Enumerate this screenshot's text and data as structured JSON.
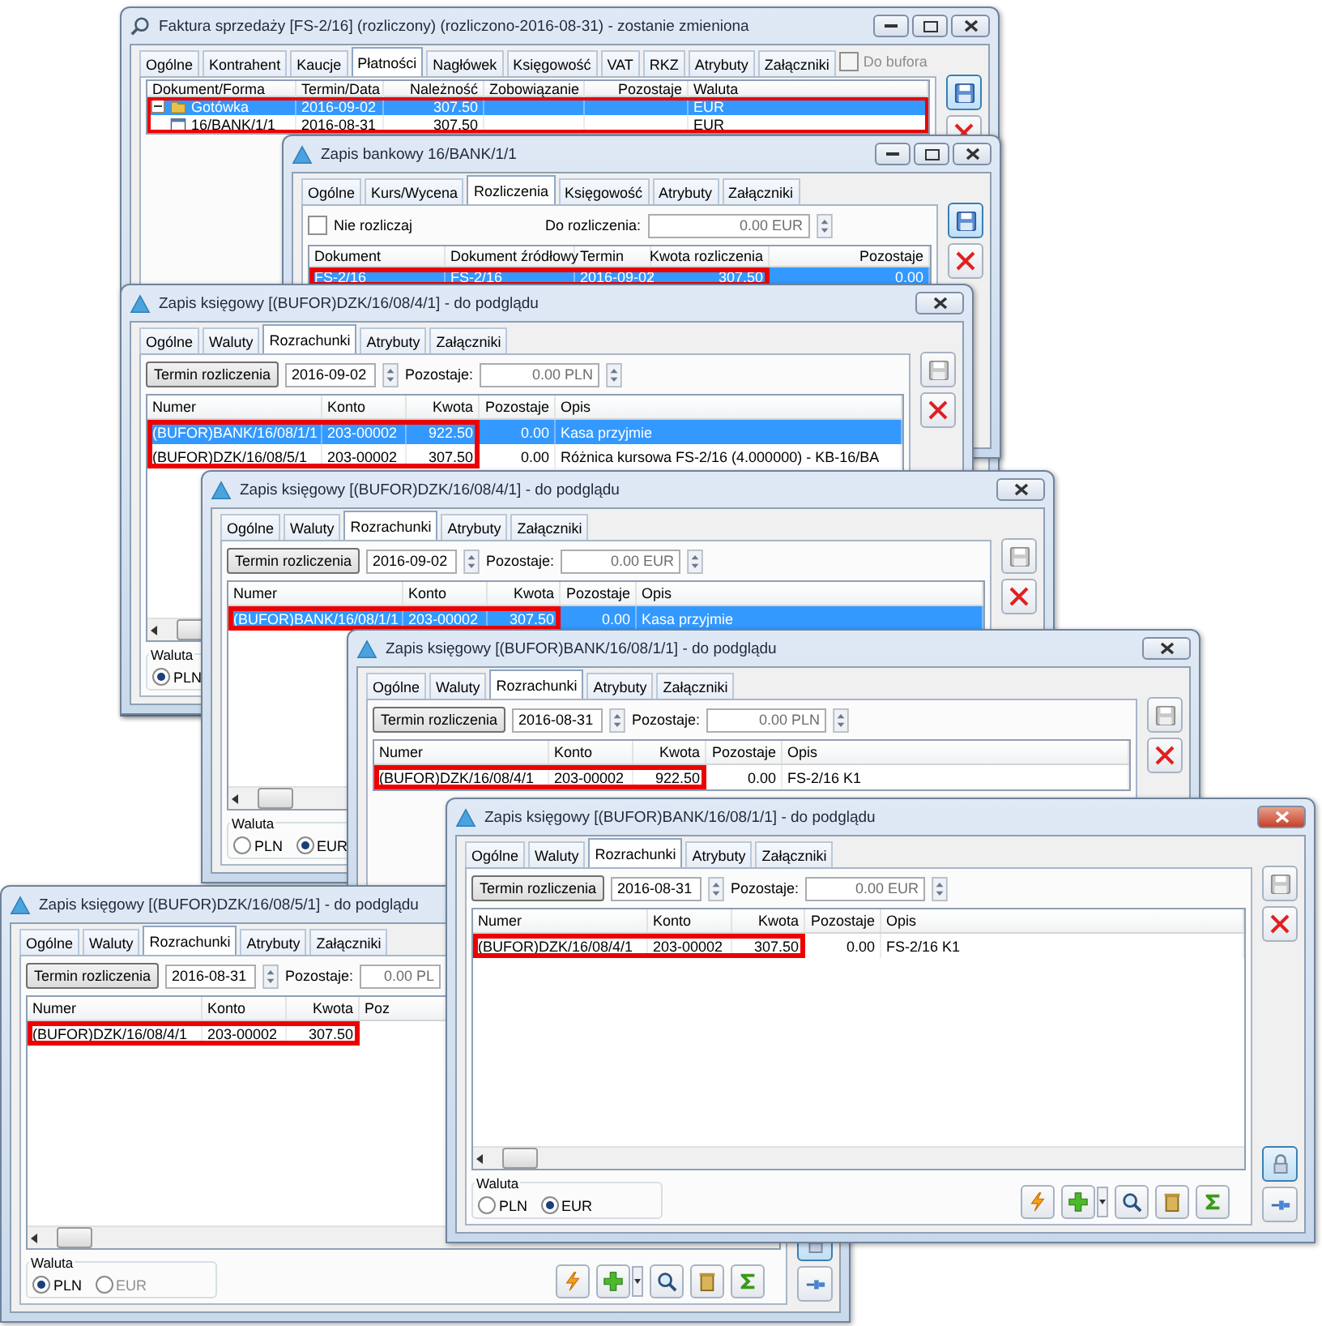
{
  "windows": [
    {
      "kind": "invoice",
      "title": "Faktura sprzedaży [FS-2/16] (rozliczony) (rozliczono-2016-08-31) - zostanie zmieniona",
      "active": false,
      "save_enabled": true,
      "tabs": [
        {
          "label": "Ogólne",
          "selected": false
        },
        {
          "label": "Kontrahent",
          "selected": false
        },
        {
          "label": "Kaucje",
          "selected": false
        },
        {
          "label": "Płatności",
          "selected": true
        },
        {
          "label": "Nagłówek",
          "selected": false
        },
        {
          "label": "Księgowość",
          "selected": false
        },
        {
          "label": "VAT",
          "selected": false
        },
        {
          "label": "RKZ",
          "selected": false
        },
        {
          "label": "Atrybuty",
          "selected": false
        },
        {
          "label": "Załączniki",
          "selected": false
        }
      ],
      "do_bufora": {
        "label": "Do bufora",
        "checked": false,
        "disabled": true
      },
      "table": {
        "columns": [
          {
            "label": "Dokument/Forma"
          },
          {
            "label": "Termin/Data"
          },
          {
            "label": "Należność"
          },
          {
            "label": "Zobowiązanie"
          },
          {
            "label": "Pozostaje"
          },
          {
            "label": "Waluta"
          }
        ],
        "rows": [
          {
            "cells": [
              "Gotówka",
              "2016-09-02",
              "307.50",
              "",
              "",
              "EUR"
            ],
            "selected": true,
            "highlighted": true,
            "expanded": true,
            "children": [
              {
                "cells": [
                  "16/BANK/1/1",
                  "2016-08-31",
                  "307.50",
                  "",
                  "",
                  "EUR"
                ],
                "selected": false,
                "highlighted": true
              }
            ]
          }
        ]
      }
    },
    {
      "kind": "bank",
      "title": "Zapis bankowy 16/BANK/1/1",
      "active": false,
      "save_enabled": true,
      "tabs": [
        {
          "label": "Ogólne",
          "selected": false
        },
        {
          "label": "Kurs/Wycena",
          "selected": false
        },
        {
          "label": "Rozliczenia",
          "selected": true
        },
        {
          "label": "Księgowość",
          "selected": false
        },
        {
          "label": "Atrybuty",
          "selected": false
        },
        {
          "label": "Załączniki",
          "selected": false
        }
      ],
      "filter": {
        "kind": "settle",
        "checkbox": {
          "label": "Nie rozliczaj",
          "checked": false
        },
        "label": "Do rozliczenia:",
        "value": "0.00 EUR"
      },
      "table": {
        "columns": [
          {
            "label": "Dokument"
          },
          {
            "label": "Dokument źródłowy"
          },
          {
            "label": "Termin"
          },
          {
            "label": "Kwota rozliczenia"
          },
          {
            "label": "Pozostaje"
          }
        ],
        "rows": [
          {
            "cells": [
              "FS-2/16",
              "FS-2/16",
              "2016-09-02",
              "307.50",
              "0.00"
            ],
            "selected": true,
            "highlighted": true
          }
        ]
      }
    },
    {
      "kind": "ledger",
      "title": "Zapis księgowy [(BUFOR)DZK/16/08/4/1] - do podglądu",
      "active": false,
      "save_enabled": false,
      "tabs": [
        {
          "label": "Ogólne",
          "selected": false
        },
        {
          "label": "Waluty",
          "selected": false
        },
        {
          "label": "Rozrachunki",
          "selected": true
        },
        {
          "label": "Atrybuty",
          "selected": false
        },
        {
          "label": "Załączniki",
          "selected": false
        }
      ],
      "filter": {
        "kind": "term",
        "button": "Termin rozliczenia",
        "date": "2016-09-02",
        "label": "Pozostaje:",
        "value": "0.00 PLN"
      },
      "table": {
        "columns": [
          {
            "label": "Numer"
          },
          {
            "label": "Konto"
          },
          {
            "label": "Kwota"
          },
          {
            "label": "Pozostaje"
          },
          {
            "label": "Opis"
          }
        ],
        "rows": [
          {
            "cells": [
              "(BUFOR)BANK/16/08/1/1",
              "203-00002",
              "922.50",
              "0.00",
              "Kasa przyjmie"
            ],
            "selected": true,
            "highlighted": true
          },
          {
            "cells": [
              "(BUFOR)DZK/16/08/5/1",
              "203-00002",
              "307.50",
              "0.00",
              "Różnica kursowa FS-2/16 (4.000000) - KB-16/BA"
            ],
            "selected": false,
            "highlighted": true
          }
        ]
      },
      "waluta": {
        "label": "Waluta",
        "options": [
          {
            "label": "PLN",
            "selected": true,
            "disabled": false
          }
        ]
      }
    },
    {
      "kind": "ledger",
      "title": "Zapis księgowy [(BUFOR)DZK/16/08/4/1] - do podglądu",
      "active": false,
      "save_enabled": false,
      "tabs": [
        {
          "label": "Ogólne",
          "selected": false
        },
        {
          "label": "Waluty",
          "selected": false
        },
        {
          "label": "Rozrachunki",
          "selected": true
        },
        {
          "label": "Atrybuty",
          "selected": false
        },
        {
          "label": "Załączniki",
          "selected": false
        }
      ],
      "filter": {
        "kind": "term",
        "button": "Termin rozliczenia",
        "date": "2016-09-02",
        "label": "Pozostaje:",
        "value": "0.00 EUR"
      },
      "table": {
        "columns": [
          {
            "label": "Numer"
          },
          {
            "label": "Konto"
          },
          {
            "label": "Kwota"
          },
          {
            "label": "Pozostaje"
          },
          {
            "label": "Opis"
          }
        ],
        "rows": [
          {
            "cells": [
              "(BUFOR)BANK/16/08/1/1",
              "203-00002",
              "307.50",
              "0.00",
              "Kasa przyjmie"
            ],
            "selected": true,
            "highlighted": true
          }
        ]
      },
      "waluta": {
        "label": "Waluta",
        "options": [
          {
            "label": "PLN",
            "selected": false,
            "disabled": false
          },
          {
            "label": "EUR",
            "selected": true,
            "disabled": false
          }
        ]
      }
    },
    {
      "kind": "ledger",
      "title": "Zapis księgowy [(BUFOR)BANK/16/08/1/1] - do podglądu",
      "active": false,
      "save_enabled": false,
      "tabs": [
        {
          "label": "Ogólne",
          "selected": false
        },
        {
          "label": "Waluty",
          "selected": false
        },
        {
          "label": "Rozrachunki",
          "selected": true
        },
        {
          "label": "Atrybuty",
          "selected": false
        },
        {
          "label": "Załączniki",
          "selected": false
        }
      ],
      "filter": {
        "kind": "term",
        "button": "Termin rozliczenia",
        "date": "2016-08-31",
        "label": "Pozostaje:",
        "value": "0.00 PLN"
      },
      "table": {
        "columns": [
          {
            "label": "Numer"
          },
          {
            "label": "Konto"
          },
          {
            "label": "Kwota"
          },
          {
            "label": "Pozostaje"
          },
          {
            "label": "Opis"
          }
        ],
        "rows": [
          {
            "cells": [
              "(BUFOR)DZK/16/08/4/1",
              "203-00002",
              "922.50",
              "0.00",
              "FS-2/16 K1"
            ],
            "selected": false,
            "highlighted": true
          }
        ]
      }
    },
    {
      "kind": "ledger",
      "title": "Zapis księgowy [(BUFOR)DZK/16/08/5/1] - do podglądu",
      "toolbar": true,
      "tabs": [
        {
          "label": "Ogólne",
          "selected": false
        },
        {
          "label": "Waluty",
          "selected": false
        },
        {
          "label": "Rozrachunki",
          "selected": true
        },
        {
          "label": "Atrybuty",
          "selected": false
        },
        {
          "label": "Załączniki",
          "selected": false
        }
      ],
      "filter": {
        "kind": "term",
        "button": "Termin rozliczenia",
        "date": "2016-08-31",
        "label": "Pozostaje:",
        "value": "0.00 PL"
      },
      "table": {
        "columns": [
          {
            "label": "Numer"
          },
          {
            "label": "Konto"
          },
          {
            "label": "Kwota"
          },
          {
            "label": "Poz"
          }
        ],
        "rows": [
          {
            "cells": [
              "(BUFOR)DZK/16/08/4/1",
              "203-00002",
              "307.50"
            ],
            "selected": false,
            "highlighted": true
          }
        ]
      },
      "waluta": {
        "label": "Waluta",
        "options": [
          {
            "label": "PLN",
            "selected": true,
            "disabled": false
          },
          {
            "label": "EUR",
            "selected": false,
            "disabled": true
          }
        ]
      }
    },
    {
      "kind": "ledger",
      "title": "Zapis księgowy [(BUFOR)BANK/16/08/1/1] - do podglądu",
      "active": true,
      "save_enabled": false,
      "toolbar": true,
      "tabs": [
        {
          "label": "Ogólne",
          "selected": false
        },
        {
          "label": "Waluty",
          "selected": false
        },
        {
          "label": "Rozrachunki",
          "selected": true
        },
        {
          "label": "Atrybuty",
          "selected": false
        },
        {
          "label": "Załączniki",
          "selected": false
        }
      ],
      "filter": {
        "kind": "term",
        "button": "Termin rozliczenia",
        "date": "2016-08-31",
        "label": "Pozostaje:",
        "value": "0.00 EUR"
      },
      "table": {
        "columns": [
          {
            "label": "Numer"
          },
          {
            "label": "Konto"
          },
          {
            "label": "Kwota"
          },
          {
            "label": "Pozostaje"
          },
          {
            "label": "Opis"
          }
        ],
        "rows": [
          {
            "cells": [
              "(BUFOR)DZK/16/08/4/1",
              "203-00002",
              "307.50",
              "0.00",
              "FS-2/16 K1"
            ],
            "selected": false,
            "highlighted": true
          }
        ]
      },
      "waluta": {
        "label": "Waluta",
        "options": [
          {
            "label": "PLN",
            "selected": false,
            "disabled": false
          },
          {
            "label": "EUR",
            "selected": true,
            "disabled": false
          }
        ]
      }
    }
  ]
}
